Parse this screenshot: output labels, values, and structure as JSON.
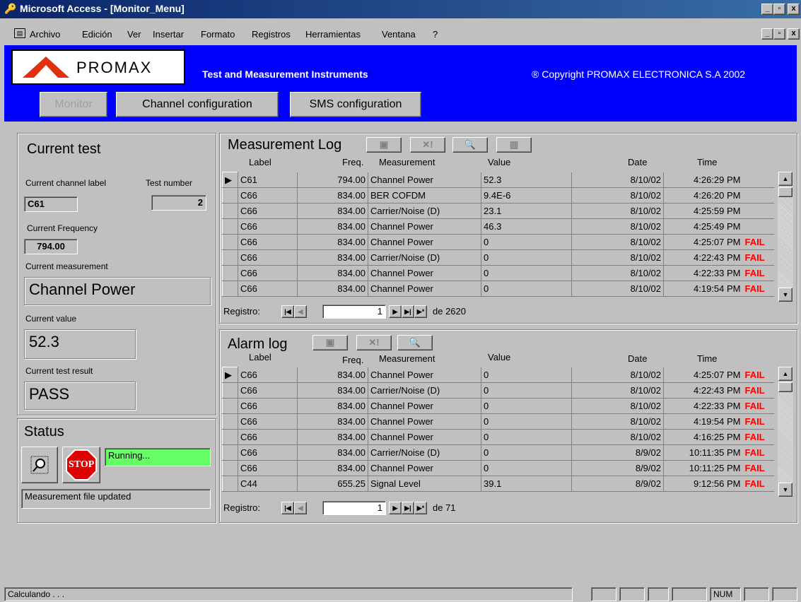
{
  "window": {
    "title": "Microsoft Access - [Monitor_Menu]"
  },
  "menu": {
    "items": [
      "Archivo",
      "Edición",
      "Ver",
      "Insertar",
      "Formato",
      "Registros",
      "Herramientas",
      "Ventana",
      "?"
    ]
  },
  "header": {
    "logo_text": "PROMAX",
    "tagline": "Test and Measurement Instruments",
    "copyright": "® Copyright PROMAX ELECTRONICA S.A 2002",
    "tabs": [
      "Monitor",
      "Channel configuration",
      "SMS configuration"
    ]
  },
  "current_test": {
    "title": "Current test",
    "channel_label_caption": "Current channel label",
    "channel_label": "C61",
    "test_number_caption": "Test number",
    "test_number": "2",
    "frequency_caption": "Current Frequency",
    "frequency": "794.00",
    "measurement_caption": "Current measurement",
    "measurement": "Channel Power",
    "value_caption": "Current value",
    "value": "52.3",
    "result_caption": "Current test result",
    "result": "PASS"
  },
  "status": {
    "title": "Status",
    "stop_label": "STOP",
    "running": "Running...",
    "message": "Measurement file updated"
  },
  "columns": {
    "label": "Label",
    "freq": "Freq.",
    "measurement": "Measurement",
    "value": "Value",
    "date": "Date",
    "time": "Time"
  },
  "measurement_log": {
    "title": "Measurement Log",
    "rows": [
      [
        "C61",
        "794.00",
        "Channel Power",
        "52.3",
        "8/10/02",
        "4:26:29 PM",
        ""
      ],
      [
        "C66",
        "834.00",
        "BER COFDM",
        "9.4E-6",
        "8/10/02",
        "4:26:20 PM",
        ""
      ],
      [
        "C66",
        "834.00",
        "Carrier/Noise (D)",
        "23.1",
        "8/10/02",
        "4:25:59 PM",
        ""
      ],
      [
        "C66",
        "834.00",
        "Channel Power",
        "46.3",
        "8/10/02",
        "4:25:49 PM",
        ""
      ],
      [
        "C66",
        "834.00",
        "Channel Power",
        "0",
        "8/10/02",
        "4:25:07 PM",
        "FAIL"
      ],
      [
        "C66",
        "834.00",
        "Carrier/Noise (D)",
        "0",
        "8/10/02",
        "4:22:43 PM",
        "FAIL"
      ],
      [
        "C66",
        "834.00",
        "Channel Power",
        "0",
        "8/10/02",
        "4:22:33 PM",
        "FAIL"
      ],
      [
        "C66",
        "834.00",
        "Channel Power",
        "0",
        "8/10/02",
        "4:19:54 PM",
        "FAIL"
      ]
    ],
    "nav": {
      "label": "Registro:",
      "current": "1",
      "total": "de  2620"
    }
  },
  "alarm_log": {
    "title": "Alarm log",
    "rows": [
      [
        "C66",
        "834.00",
        "Channel Power",
        "0",
        "8/10/02",
        "4:25:07 PM",
        "FAIL"
      ],
      [
        "C66",
        "834.00",
        "Carrier/Noise (D)",
        "0",
        "8/10/02",
        "4:22:43 PM",
        "FAIL"
      ],
      [
        "C66",
        "834.00",
        "Channel Power",
        "0",
        "8/10/02",
        "4:22:33 PM",
        "FAIL"
      ],
      [
        "C66",
        "834.00",
        "Channel Power",
        "0",
        "8/10/02",
        "4:19:54 PM",
        "FAIL"
      ],
      [
        "C66",
        "834.00",
        "Channel Power",
        "0",
        "8/10/02",
        "4:16:25 PM",
        "FAIL"
      ],
      [
        "C66",
        "834.00",
        "Carrier/Noise (D)",
        "0",
        "8/9/02",
        "10:11:35 PM",
        "FAIL"
      ],
      [
        "C66",
        "834.00",
        "Channel Power",
        "0",
        "8/9/02",
        "10:11:25 PM",
        "FAIL"
      ],
      [
        "C44",
        "655.25",
        "Signal Level",
        "39.1",
        "8/9/02",
        "9:12:56 PM",
        "FAIL"
      ]
    ],
    "nav": {
      "label": "Registro:",
      "current": "1",
      "total": "de  71"
    }
  },
  "statusbar": {
    "text": "Calculando . . .",
    "num": "NUM"
  },
  "colors": {
    "header_blue": "#0000ff",
    "fail_red": "#ff0000",
    "running_green": "#66ff66",
    "title_navy": "#0a246a"
  }
}
